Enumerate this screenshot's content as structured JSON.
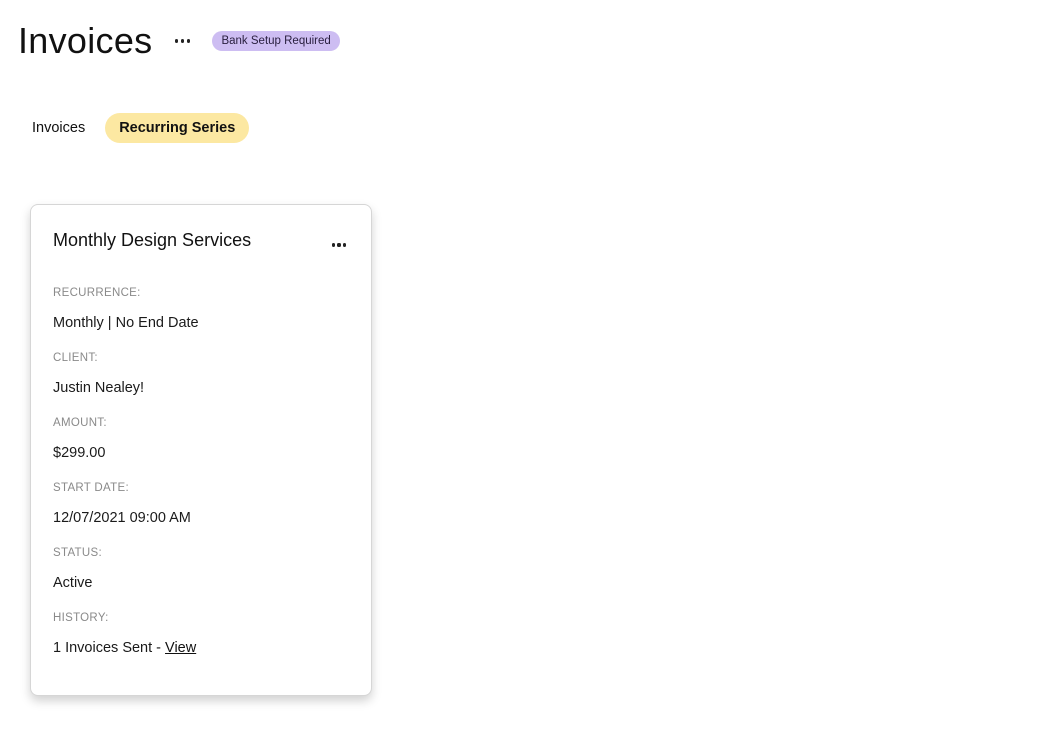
{
  "header": {
    "title": "Invoices",
    "badge": "Bank Setup Required"
  },
  "tabs": [
    {
      "label": "Invoices",
      "active": false
    },
    {
      "label": "Recurring Series",
      "active": true
    }
  ],
  "card": {
    "title": "Monthly Design Services",
    "fields": {
      "recurrence": {
        "label": "RECURRENCE:",
        "value": "Monthly | No End Date"
      },
      "client": {
        "label": "CLIENT:",
        "value": "Justin Nealey!"
      },
      "amount": {
        "label": "AMOUNT:",
        "value": "$299.00"
      },
      "start_date": {
        "label": "START DATE:",
        "value": "12/07/2021 09:00 AM"
      },
      "status": {
        "label": "STATUS:",
        "value": "Active"
      },
      "history": {
        "label": "HISTORY:",
        "value": "1 Invoices Sent - ",
        "link": "View"
      }
    }
  },
  "colors": {
    "badge_bg": "#cdbdf2",
    "active_tab_bg": "#fce8a2"
  },
  "icons": {
    "header_more": "more-horizontal-icon",
    "card_more": "more-horizontal-icon"
  }
}
